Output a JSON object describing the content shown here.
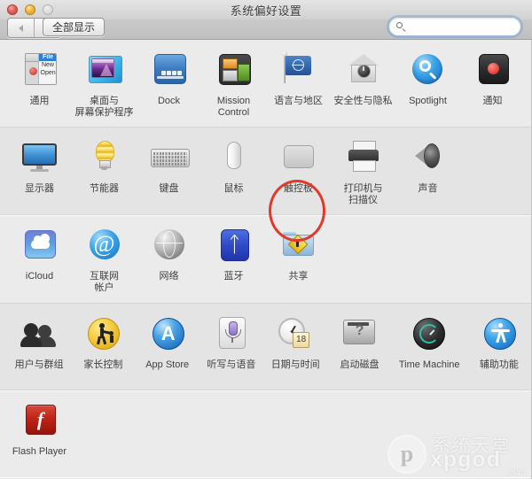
{
  "window": {
    "title": "系统偏好设置",
    "traffic_lights": [
      "close",
      "minimize",
      "zoom"
    ]
  },
  "toolbar": {
    "back_label": "◀",
    "forward_label": "▶",
    "show_all_label": "全部显示",
    "search": {
      "value": "",
      "placeholder": ""
    }
  },
  "highlight": {
    "target": "触控板",
    "color": "#e2392b"
  },
  "watermark": {
    "mark": "p",
    "chinese": "系统天堂",
    "english": "xpgod",
    "domain": ".com"
  },
  "rows": [
    {
      "items": [
        {
          "label": "通用",
          "icon": "general-icon",
          "menu_header": "File",
          "menu_items": [
            "New",
            "Open"
          ]
        },
        {
          "label": "桌面与\n屏幕保护程序",
          "icon": "desktop-screensaver-icon"
        },
        {
          "label": "Dock",
          "icon": "dock-icon"
        },
        {
          "label": "Mission\nControl",
          "icon": "mission-control-icon"
        },
        {
          "label": "语言与地区",
          "icon": "language-region-icon"
        },
        {
          "label": "安全性与隐私",
          "icon": "security-privacy-icon"
        },
        {
          "label": "Spotlight",
          "icon": "spotlight-icon"
        },
        {
          "label": "通知",
          "icon": "notifications-icon"
        }
      ]
    },
    {
      "items": [
        {
          "label": "显示器",
          "icon": "displays-icon"
        },
        {
          "label": "节能器",
          "icon": "energy-saver-icon"
        },
        {
          "label": "键盘",
          "icon": "keyboard-icon"
        },
        {
          "label": "鼠标",
          "icon": "mouse-icon"
        },
        {
          "label": "触控板",
          "icon": "trackpad-icon"
        },
        {
          "label": "打印机与\n扫描仪",
          "icon": "printers-scanners-icon"
        },
        {
          "label": "声音",
          "icon": "sound-icon"
        }
      ]
    },
    {
      "items": [
        {
          "label": "iCloud",
          "icon": "icloud-icon"
        },
        {
          "label": "互联网\n帐户",
          "icon": "internet-accounts-icon"
        },
        {
          "label": "网络",
          "icon": "network-icon"
        },
        {
          "label": "蓝牙",
          "icon": "bluetooth-icon"
        },
        {
          "label": "共享",
          "icon": "sharing-icon"
        }
      ]
    },
    {
      "items": [
        {
          "label": "用户与群组",
          "icon": "users-groups-icon"
        },
        {
          "label": "家长控制",
          "icon": "parental-controls-icon"
        },
        {
          "label": "App Store",
          "icon": "app-store-icon"
        },
        {
          "label": "听写与语音",
          "icon": "dictation-speech-icon"
        },
        {
          "label": "日期与时间",
          "icon": "date-time-icon",
          "calendar_day": "18"
        },
        {
          "label": "启动磁盘",
          "icon": "startup-disk-icon",
          "glyph": "?"
        },
        {
          "label": "Time Machine",
          "icon": "time-machine-icon"
        },
        {
          "label": "辅助功能",
          "icon": "accessibility-icon"
        }
      ]
    },
    {
      "items": [
        {
          "label": "Flash Player",
          "icon": "flash-player-icon",
          "glyph": "f"
        }
      ]
    }
  ]
}
